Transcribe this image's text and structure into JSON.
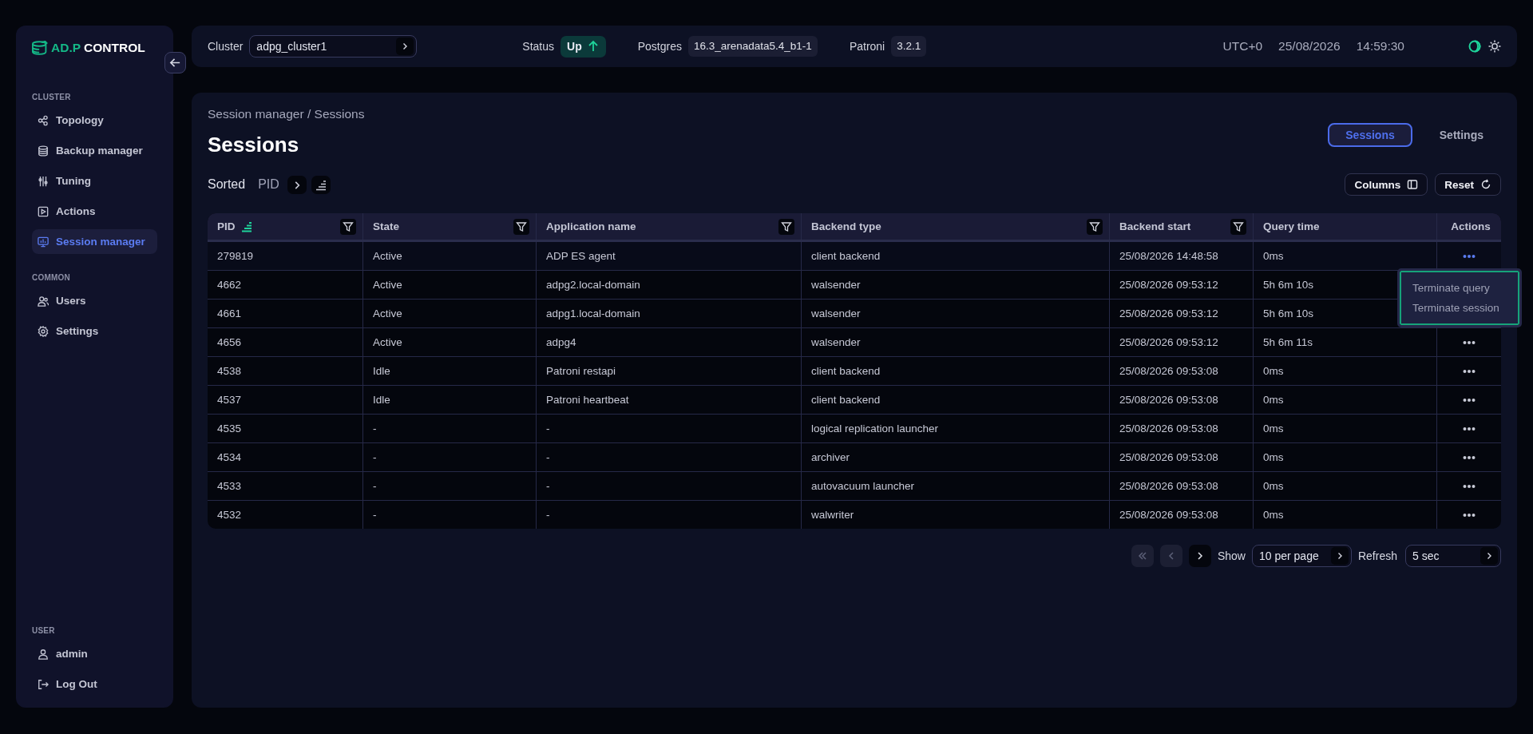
{
  "sidebar": {
    "logo": {
      "prefix": "AD.P",
      "suffix": "CONTROL"
    },
    "sections": [
      {
        "title": "CLUSTER",
        "items": [
          {
            "label": "Topology",
            "selected": false
          },
          {
            "label": "Backup manager",
            "selected": false
          },
          {
            "label": "Tuning",
            "selected": false
          },
          {
            "label": "Actions",
            "selected": false
          },
          {
            "label": "Session manager",
            "selected": true
          }
        ]
      },
      {
        "title": "COMMON",
        "items": [
          {
            "label": "Users",
            "selected": false
          },
          {
            "label": "Settings",
            "selected": false
          }
        ]
      }
    ],
    "user": {
      "title": "USER",
      "items": [
        {
          "label": "admin",
          "selected": false
        },
        {
          "label": "Log Out",
          "selected": false
        }
      ]
    }
  },
  "topbar": {
    "cluster_label": "Cluster",
    "cluster_value": "adpg_cluster1",
    "status_label": "Status",
    "status_value": "Up",
    "postgres_label": "Postgres",
    "postgres_value": "16.3_arenadata5.4_b1-1",
    "patroni_label": "Patroni",
    "patroni_value": "3.2.1",
    "timezone": "UTC+0",
    "date": "25/08/2026",
    "time": "14:59:30",
    "dark_theme": true
  },
  "breadcrumb": "Session manager / Sessions",
  "title": "Sessions",
  "tabs": [
    {
      "label": "Sessions",
      "selected": true
    },
    {
      "label": "Settings",
      "selected": false
    }
  ],
  "sorting": {
    "label": "Sorted",
    "field": "PID"
  },
  "buttons": [
    {
      "label": "Columns"
    },
    {
      "label": "Reset"
    }
  ],
  "table": {
    "columns": [
      {
        "label": "PID",
        "sorted": true,
        "filter": true
      },
      {
        "label": "State",
        "sorted": false,
        "filter": true
      },
      {
        "label": "Application name",
        "sorted": false,
        "filter": true
      },
      {
        "label": "Backend type",
        "sorted": false,
        "filter": true
      },
      {
        "label": "Backend start",
        "sorted": false,
        "filter": true
      },
      {
        "label": "Query time",
        "sorted": false,
        "filter": false
      },
      {
        "label": "Actions",
        "sorted": false,
        "filter": false
      }
    ],
    "rows": [
      {
        "cells": [
          "279819",
          "Active",
          "ADP ES agent",
          "client backend",
          "25/08/2026 14:48:58",
          "0ms"
        ],
        "menu_open": true
      },
      {
        "cells": [
          "4662",
          "Active",
          "adpg2.local-domain",
          "walsender",
          "25/08/2026 09:53:12",
          "5h 6m 10s"
        ],
        "menu_open": false
      },
      {
        "cells": [
          "4661",
          "Active",
          "adpg1.local-domain",
          "walsender",
          "25/08/2026 09:53:12",
          "5h 6m 10s"
        ],
        "menu_open": false
      },
      {
        "cells": [
          "4656",
          "Active",
          "adpg4",
          "walsender",
          "25/08/2026 09:53:12",
          "5h 6m 11s"
        ],
        "menu_open": false
      },
      {
        "cells": [
          "4538",
          "Idle",
          "Patroni restapi",
          "client backend",
          "25/08/2026 09:53:08",
          "0ms"
        ],
        "menu_open": false
      },
      {
        "cells": [
          "4537",
          "Idle",
          "Patroni heartbeat",
          "client backend",
          "25/08/2026 09:53:08",
          "0ms"
        ],
        "menu_open": false
      },
      {
        "cells": [
          "4535",
          "-",
          "-",
          "logical replication launcher",
          "25/08/2026 09:53:08",
          "0ms"
        ],
        "menu_open": false
      },
      {
        "cells": [
          "4534",
          "-",
          "-",
          "archiver",
          "25/08/2026 09:53:08",
          "0ms"
        ],
        "menu_open": false
      },
      {
        "cells": [
          "4533",
          "-",
          "-",
          "autovacuum launcher",
          "25/08/2026 09:53:08",
          "0ms"
        ],
        "menu_open": false
      },
      {
        "cells": [
          "4532",
          "-",
          "-",
          "walwriter",
          "25/08/2026 09:53:08",
          "0ms"
        ],
        "menu_open": false
      }
    ]
  },
  "row_menu": {
    "items": [
      "Terminate query",
      "Terminate session"
    ]
  },
  "pagination": {
    "first_disabled": true,
    "prev_disabled": true,
    "next_disabled": false,
    "show_label": "Show",
    "page_size": "10 per page",
    "refresh_label": "Refresh",
    "refresh_value": "5 sec"
  }
}
